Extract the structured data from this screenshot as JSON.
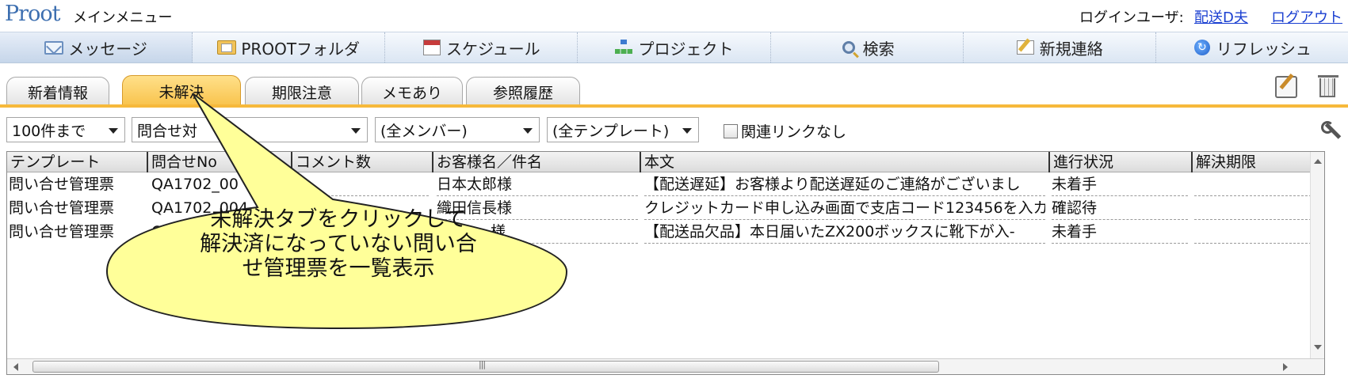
{
  "header": {
    "logo": "Proot",
    "title": "メインメニュー",
    "login_label": "ログインユーザ:",
    "user_name": "配送D夫",
    "logout": "ログアウト"
  },
  "toolbar": {
    "items": [
      {
        "label": "メッセージ",
        "icon": "mail-icon"
      },
      {
        "label": "PROOTフォルダ",
        "icon": "folder-icon"
      },
      {
        "label": "スケジュール",
        "icon": "calendar-icon"
      },
      {
        "label": "プロジェクト",
        "icon": "project-icon"
      },
      {
        "label": "検索",
        "icon": "search-icon"
      },
      {
        "label": "新規連絡",
        "icon": "new-contact-icon"
      },
      {
        "label": "リフレッシュ",
        "icon": "refresh-icon"
      }
    ]
  },
  "tabs": [
    {
      "label": "新着情報",
      "active": false
    },
    {
      "label": "未解決",
      "active": true
    },
    {
      "label": "期限注意",
      "active": false
    },
    {
      "label": "メモあり",
      "active": false
    },
    {
      "label": "参照履歴",
      "active": false
    }
  ],
  "filters": {
    "limit": "100件まで",
    "target": "問合せ対",
    "member": "(全メンバー)",
    "template": "(全テンプレート)",
    "no_link_label": "関連リンクなし"
  },
  "table": {
    "columns": [
      "テンプレート",
      "問合せNo",
      "コメント数",
      "お客様名／件名",
      "本文",
      "進行状況",
      "解決期限"
    ],
    "rows": [
      [
        "問い合せ管理票",
        "QA1702_00",
        "",
        "日本太郎様",
        "【配送遅延】お客様より配送遅延のご連絡がございまし",
        "未着手",
        ""
      ],
      [
        "問い合せ管理票",
        "QA1702_004",
        "",
        "織田信長様",
        "クレジットカード申し込み画面で支店コード123456を入カ",
        "確認待",
        ""
      ],
      [
        "問い合せ管理票",
        "Q",
        "",
        "様",
        "【配送品欠品】本日届いたZX200ボックスに靴下が入-",
        "未着手",
        ""
      ]
    ]
  },
  "callout": {
    "lines": [
      "未解決タブをクリックして",
      "解決済になっていない問い合",
      "せ管理票を一覧表示"
    ]
  },
  "colors": {
    "active_tab": "#f8c24a",
    "link": "#1a3fd1",
    "callout_fill": "#ffff99"
  }
}
